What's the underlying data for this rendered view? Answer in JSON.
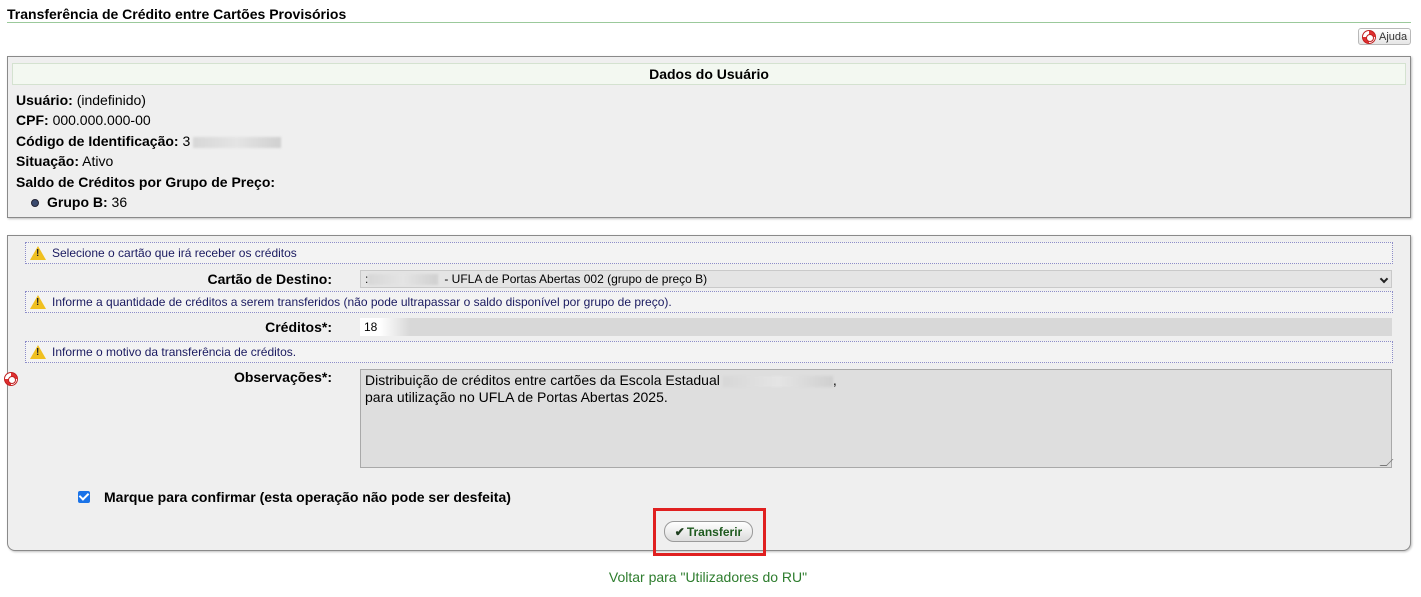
{
  "page": {
    "title": "Transferência de Crédito entre Cartões Provisórios",
    "help_label": "Ajuda"
  },
  "user_panel": {
    "header": "Dados do Usuário",
    "usuario_label": "Usuário:",
    "usuario_value": "(indefinido)",
    "cpf_label": "CPF:",
    "cpf_value": "000.000.000-00",
    "codigo_label": "Código de Identificação:",
    "codigo_value": "3",
    "situacao_label": "Situação:",
    "situacao_value": "Ativo",
    "saldo_label": "Saldo de Créditos por Grupo de Preço:",
    "grupos": [
      {
        "label": "Grupo B:",
        "value": "36"
      }
    ]
  },
  "form": {
    "warn_card": "Selecione o cartão que irá receber os créditos",
    "card_label": "Cartão de Destino:",
    "card_selected_prefix": ":",
    "card_selected": "- UFLA de Portas Abertas 002 (grupo de preço B)",
    "warn_credits": "Informe a quantidade de créditos a serem transferidos (não pode ultrapassar o saldo disponível por grupo de preço).",
    "credits_label": "Créditos*:",
    "credits_value": "18",
    "warn_reason": "Informe o motivo da transferência de créditos.",
    "obs_label": "Observações*:",
    "obs_line1": "Distribuição de créditos entre cartões da Escola Estadual",
    "obs_line1_end": ",",
    "obs_line2": "para utilização no UFLA de Portas Abertas 2025.",
    "confirm_label": "Marque para confirmar (esta operação não pode ser desfeita)",
    "confirm_checked": true,
    "submit_label": "Transferir"
  },
  "footer": {
    "back_link": "Voltar para \"Utilizadores do RU\""
  },
  "colors": {
    "accent_green": "#2e7d2e",
    "highlight_red": "#e02020",
    "warning_yellow": "#f0c020"
  }
}
